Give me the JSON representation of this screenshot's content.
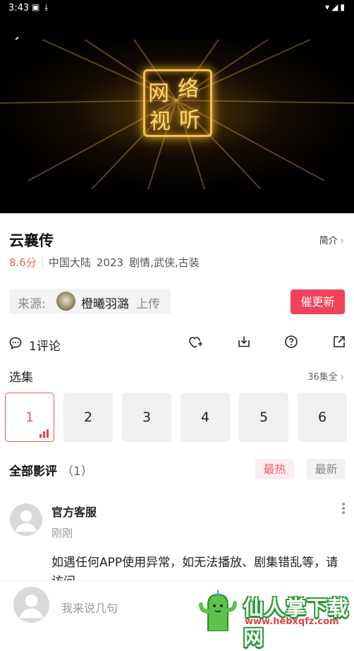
{
  "status": {
    "time": "3:43"
  },
  "title": "云襄传",
  "intro_label": "简介",
  "meta": {
    "score": "8.6分",
    "region": "中国大陆",
    "year": "2023",
    "genres": "剧情,武侠,古装"
  },
  "source": {
    "label": "来源:",
    "uploader": "橙曦羽潞",
    "upload": "上传"
  },
  "urge_button": "催更新",
  "actions": {
    "comment_count": "1评论"
  },
  "episodes": {
    "title": "选集",
    "all_label": "36集全",
    "items": [
      "1",
      "2",
      "3",
      "4",
      "5",
      "6"
    ],
    "active": "1"
  },
  "reviews": {
    "title": "全部影评",
    "count": "（1）",
    "sort_hot": "最热",
    "sort_new": "最新",
    "items": [
      {
        "author": "官方客服",
        "time": "刚刚",
        "text": "如遇任何APP使用异常，如无法播放、剧集错乱等，请访问"
      }
    ]
  },
  "input": {
    "placeholder": "我来说几句"
  },
  "watermark": {
    "text": "仙人掌下载网",
    "url": "www.hebxqfz.com"
  },
  "colors": {
    "accent": "#f2415a",
    "score": "#e46b5b",
    "watermark_green": "#2c9b3a"
  }
}
